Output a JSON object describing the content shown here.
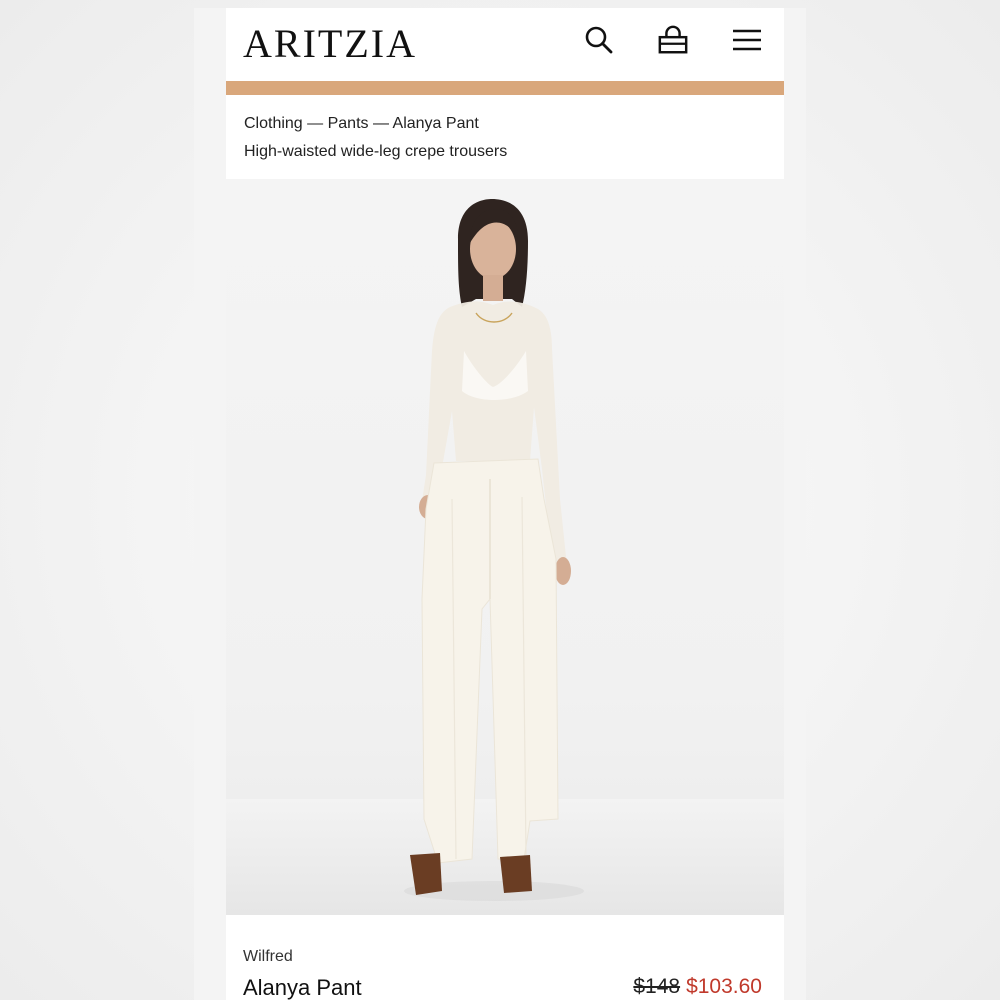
{
  "header": {
    "logo": "ARITZIA",
    "icons": [
      "search-icon",
      "bag-icon",
      "menu-icon"
    ]
  },
  "colors": {
    "accent_bar": "#d9a77b",
    "sale_price": "#c0392b"
  },
  "breadcrumb": {
    "items": [
      "Clothing",
      "Pants",
      "Alanya Pant"
    ],
    "separator": " — "
  },
  "product": {
    "subtitle": "High-waisted wide-leg crepe trousers",
    "brand": "Wilfred",
    "name": "Alanya Pant",
    "original_price": "$148",
    "sale_price": "$103.60"
  }
}
